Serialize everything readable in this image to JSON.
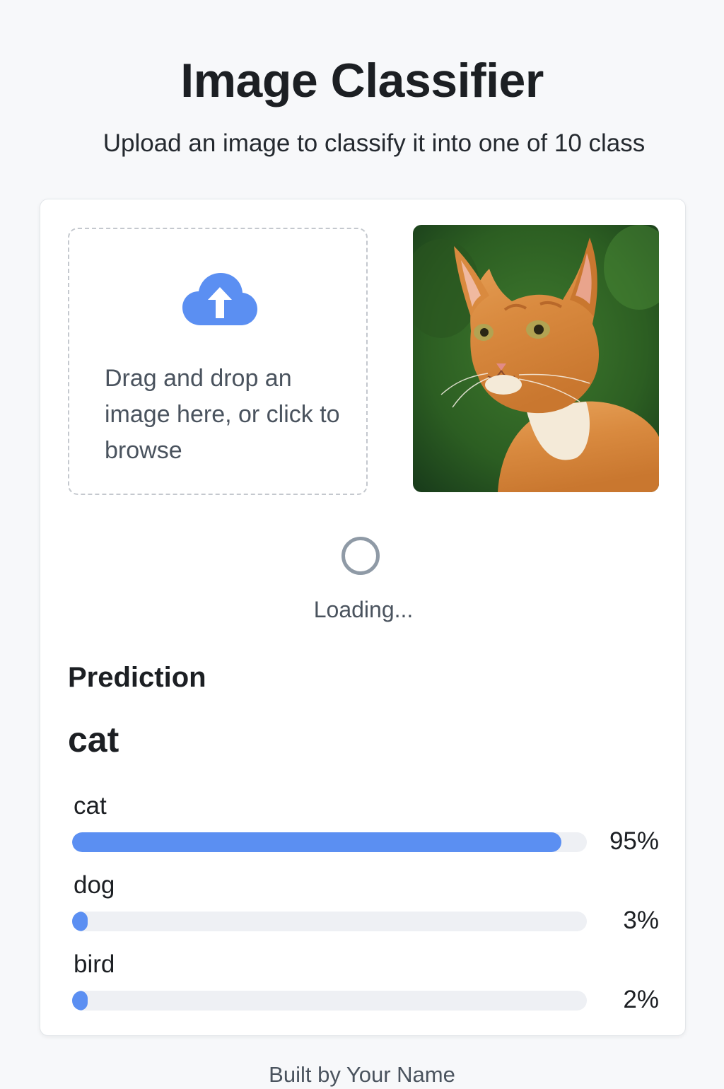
{
  "header": {
    "title": "Image Classifier",
    "subtitle": "Upload an image to classify it into one of 10 class"
  },
  "upload": {
    "icon": "cloud-upload-icon",
    "text": "Drag and drop an image here, or click to browse",
    "accent_color": "#5b8ff2"
  },
  "preview": {
    "subject": "orange tabby cat"
  },
  "status": {
    "loading_text": "Loading..."
  },
  "prediction": {
    "heading": "Prediction",
    "label": "cat",
    "results": [
      {
        "label": "cat",
        "value": 0.95,
        "percent_text": "95%"
      },
      {
        "label": "dog",
        "value": 0.03,
        "percent_text": "3%"
      },
      {
        "label": "bird",
        "value": 0.02,
        "percent_text": "2%"
      }
    ],
    "bar_color": "#5b8ff2",
    "track_color": "#eef0f4"
  },
  "footer": {
    "text": "Built by Your Name"
  }
}
